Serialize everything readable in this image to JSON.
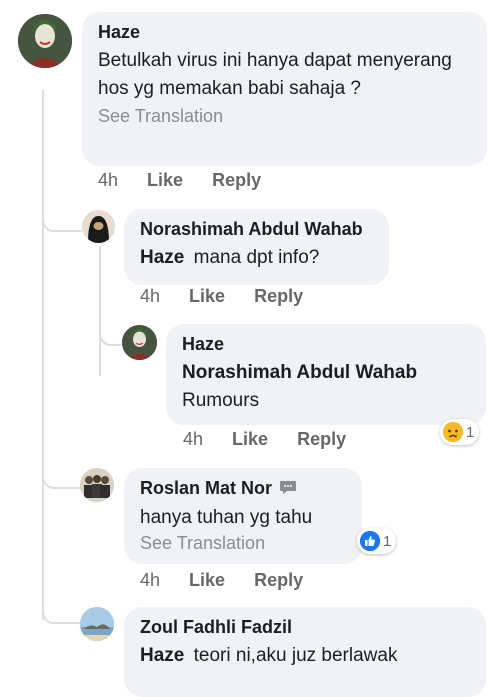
{
  "comments": [
    {
      "author": "Haze",
      "text": "Betulkah virus ini hanya dapat menyerang hos yg memakan babi sahaja ?",
      "see_translation": "See Translation",
      "time": "4h",
      "like": "Like",
      "reply": "Reply"
    },
    {
      "author": "Norashimah Abdul Wahab",
      "tag": "Haze",
      "text": "mana dpt info?",
      "time": "4h",
      "like": "Like",
      "reply": "Reply"
    },
    {
      "author": "Haze",
      "tag": "Norashimah Abdul Wahab",
      "text": "Rumours",
      "time": "4h",
      "like": "Like",
      "reply": "Reply",
      "reaction": {
        "icon": "sad-emoji-icon",
        "count": "1"
      }
    },
    {
      "author": "Roslan Mat Nor",
      "text": "hanya tuhan yg tahu",
      "see_translation": "See Translation",
      "time": "4h",
      "like": "Like",
      "reply": "Reply",
      "reaction": {
        "icon": "like-thumb-icon",
        "count": "1"
      }
    },
    {
      "author": "Zoul Fadhli Fadzil",
      "tag": "Haze",
      "text": "teori ni,aku juz berlawak"
    }
  ],
  "colors": {
    "bubble": "#f0f2f5",
    "meta": "#65676b",
    "translate": "#8a8d91",
    "like_blue": "#1877f2",
    "sad_yellow": "#f7b928"
  }
}
